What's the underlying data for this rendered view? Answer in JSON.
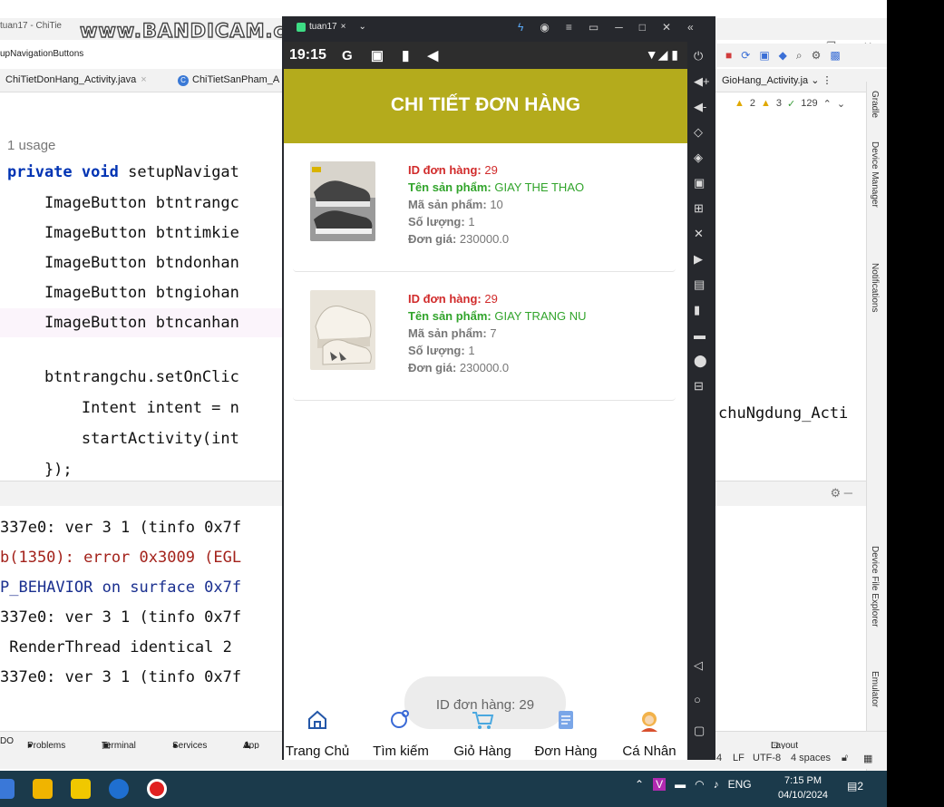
{
  "ide": {
    "title": "tuan17 - ChiTie",
    "breadcrumb": "upNavigationButtons",
    "tab1": "ChiTietDonHang_Activity.java",
    "tab2": "ChiTietSanPham_A",
    "tab_right": "GioHang_Activity.ja",
    "inspection": {
      "warn_a": "2",
      "warn_b": "3",
      "ok": "129"
    },
    "code_usage": "1 usage",
    "code_lines": [
      "private void setupNavigat",
      "    ImageButton btntrangc",
      "    ImageButton btntimkie",
      "    ImageButton btndonhan",
      "    ImageButton btngiohan",
      "    ImageButton btncanhan",
      "",
      "    btntrangchu.setOnClic",
      "        Intent intent = n",
      "        startActivity(int",
      "    });"
    ],
    "code_right": "chuNgdung_Acti",
    "log_lines": [
      "337e0: ver 3 1 (tinfo 0x7f",
      "b(1350): error 0x3009 (EGL",
      "P_BEHAVIOR on surface 0x7f",
      "337e0: ver 3 1 (tinfo 0x7f",
      " RenderThread identical 2",
      "337e0: ver 3 1 (tinfo 0x7f"
    ],
    "right_strip": {
      "gradle": "Gradle",
      "device_manager": "Device Manager",
      "notifications": "Notifications",
      "file_explorer": "Device File Explorer",
      "emulator": "Emulator"
    },
    "bottom_tabs": [
      "DO",
      "Problems",
      "Terminal",
      "Services",
      "App I"
    ],
    "layout_inspector": "Layout Inspector",
    "status": {
      "pos": "4",
      "lf": "LF",
      "enc": "UTF-8",
      "indent": "4 spaces"
    }
  },
  "watermark": "www.BANDICAM.com",
  "emulator": {
    "tab_title": "tuan17",
    "status_time": "19:15",
    "status_icons": "G ▣ ▮ ◀",
    "appbar_title": "CHI TIẾT ĐƠN HÀNG",
    "items": [
      {
        "id_label": "ID đơn hàng:",
        "id_value": "29",
        "name_label": "Tên sản phẩm:",
        "name_value": "GIAY THE THAO",
        "code_label": "Mã sản phẩm:",
        "code_value": "10",
        "qty_label": "Số lượng:",
        "qty_value": "1",
        "price_label": "Đơn giá:",
        "price_value": "230000.0"
      },
      {
        "id_label": "ID đơn hàng:",
        "id_value": "29",
        "name_label": "Tên sản phẩm:",
        "name_value": "GIAY TRANG NU",
        "code_label": "Mã sản phẩm:",
        "code_value": "7",
        "qty_label": "Số lượng:",
        "qty_value": "1",
        "price_label": "Đơn giá:",
        "price_value": "230000.0"
      }
    ],
    "toast": "ID đơn hàng: 29",
    "nav": [
      {
        "label": "Trang Chủ",
        "icon": "home-icon"
      },
      {
        "label": "Tìm kiếm",
        "icon": "search-icon"
      },
      {
        "label": "Giỏ Hàng",
        "icon": "cart-icon"
      },
      {
        "label": "Đơn Hàng",
        "icon": "order-icon"
      },
      {
        "label": "Cá Nhân",
        "icon": "profile-icon"
      }
    ]
  },
  "taskbar": {
    "lang": "ENG",
    "time": "7:15 PM",
    "date": "04/10/2024",
    "notif_count": "2"
  },
  "colors": {
    "appbar": "#b4ab1c",
    "red_label": "#d12b2b",
    "green_label": "#31a42b"
  }
}
